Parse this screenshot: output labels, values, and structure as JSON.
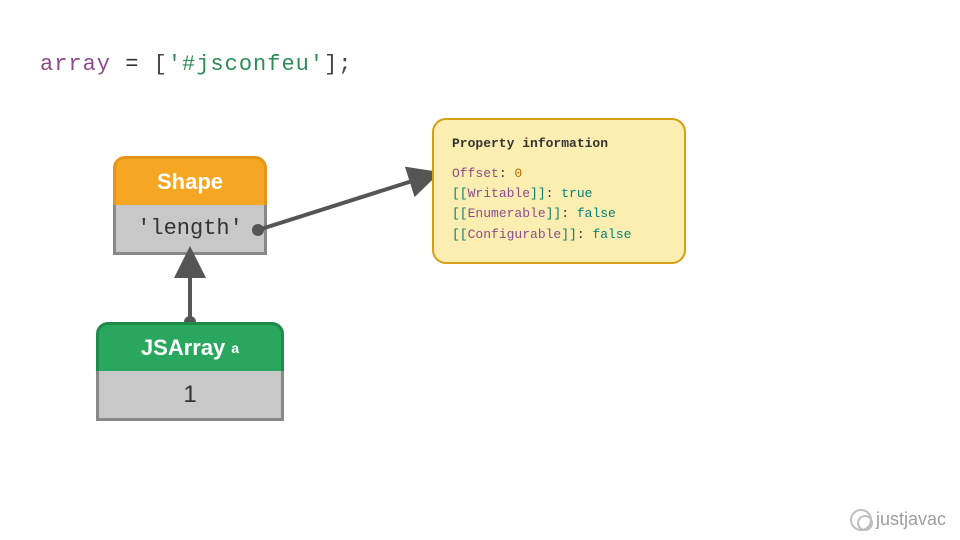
{
  "code": {
    "variable": "array",
    "op": " = ",
    "lbr": "[",
    "string": "'#jsconfeu'",
    "rbr": "];"
  },
  "shape": {
    "header": "Shape",
    "property": "'length'"
  },
  "jsarray": {
    "header": "JSArray",
    "suffix": "a",
    "value": "1"
  },
  "info": {
    "title": "Property information",
    "offset_label": "Offset",
    "offset_value": "0",
    "writable_key": "Writable",
    "writable_value": "true",
    "enumerable_key": "Enumerable",
    "enumerable_value": "false",
    "configurable_key": "Configurable",
    "configurable_value": "false"
  },
  "watermark": "justjavac"
}
